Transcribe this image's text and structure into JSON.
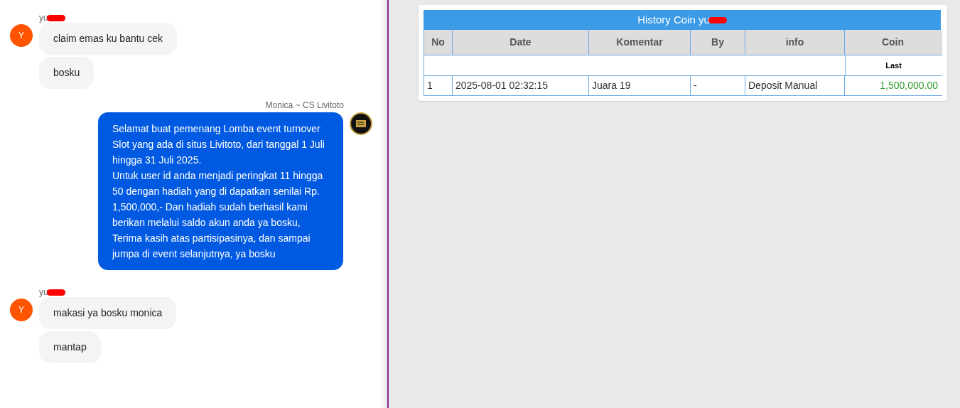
{
  "chat": [
    {
      "kind": "incoming",
      "sender": "yu",
      "avatar": "Y",
      "bubbles": [
        "claim emas ku bantu cek",
        "bosku"
      ]
    },
    {
      "kind": "outgoing",
      "sender": "Monica ~ CS Livitoto",
      "bubbles": [
        "Selamat buat pemenang Lomba event turnover Slot yang ada di situs Livitoto, dari tanggal 1 Juli hingga 31 Juli 2025.\nUntuk user id anda menjadi peringkat 11 hingga 50 dengan hadiah yang di dapatkan senilai Rp. 1,500,000,- Dan hadiah sudah berhasil kami berikan melalui saldo akun anda ya bosku, Terima kasih atas partisipasinya, dan sampai jumpa di event selanjutnya, ya bosku"
      ]
    },
    {
      "kind": "incoming",
      "sender": "yu",
      "avatar": "Y",
      "bubbles": [
        "makasi ya bosku monica",
        "mantap"
      ]
    }
  ],
  "history": {
    "title": "History Coin yu",
    "columns": [
      "No",
      "Date",
      "Komentar",
      "By",
      "info",
      "Coin"
    ],
    "subheader": "Last",
    "rows": [
      [
        "1",
        "2025-08-01 02:32:15",
        "Juara 19",
        "-",
        "Deposit Manual",
        "1,500,000.00"
      ]
    ]
  }
}
